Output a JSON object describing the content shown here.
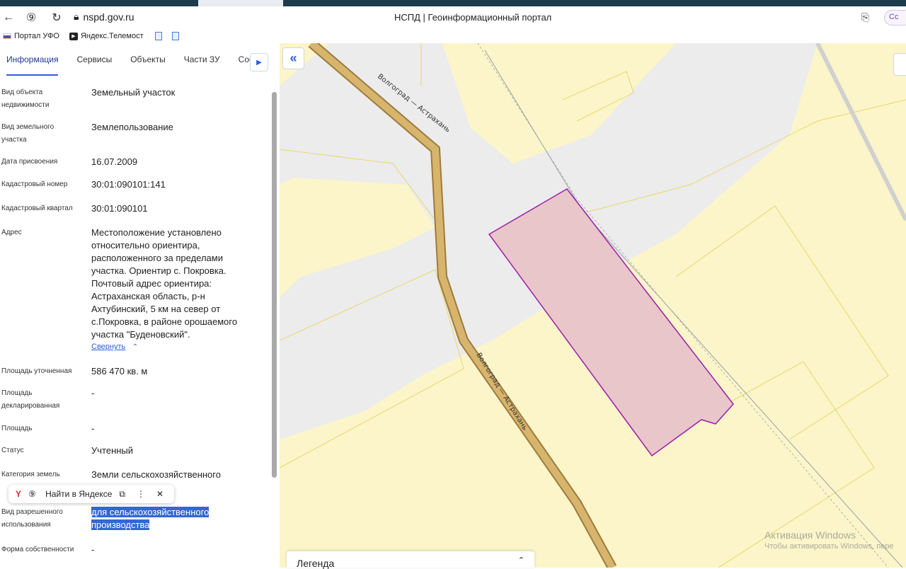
{
  "browser": {
    "url": "nspd.gov.ru",
    "title": "НСПД | Геоинформационный портал",
    "extension_chip": "Сс",
    "bookmarks": [
      {
        "label": "Портал УФО"
      },
      {
        "label": "Яндекс.Телемост"
      }
    ]
  },
  "panel": {
    "tabs": [
      "Информация",
      "Сервисы",
      "Объекты",
      "Части ЗУ",
      "Соста"
    ],
    "active_tab": "Информация",
    "fields": [
      {
        "label": "Вид объекта недвижимости",
        "value": "Земельный участок"
      },
      {
        "label": "Вид земельного участка",
        "value": "Землепользование"
      },
      {
        "label": "Дата присвоения",
        "value": "16.07.2009"
      },
      {
        "label": "Кадастровый номер",
        "value": "30:01:090101:141"
      },
      {
        "label": "Кадастровый квартал",
        "value": "30:01:090101"
      },
      {
        "label": "Адрес",
        "value": "Местоположение установлено относительно ориентира, расположенного за пределами участка. Ориентир с. Покровка. Почтовый адрес ориентира: Астраханская область, р-н Ахтубинский, 5 км на север от с.Покровка, в районе орошаемого участка \"Буденовский\"."
      },
      {
        "label": "Площадь уточненная",
        "value": "586 470 кв. м"
      },
      {
        "label": "Площадь декларированная",
        "value": "-"
      },
      {
        "label": "Площадь",
        "value": "-"
      },
      {
        "label": "Статус",
        "value": "Учтенный"
      },
      {
        "label": "Категория земель",
        "value": "Земли сельскохозяйственного"
      },
      {
        "label": "Вид разрешенного использования",
        "value": "для сельскохозяйственного производства"
      },
      {
        "label": "Форма собственности",
        "value": "-"
      }
    ],
    "collapse_link": "Свернуть"
  },
  "popup": {
    "search_label": "Найти в Яндексе"
  },
  "map": {
    "road_label": "Волгоград — Астрахань",
    "legend_title": "Легенда",
    "watermark_line1": "Активация Windows",
    "watermark_line2": "Чтобы активировать Windows, пере",
    "background_color": "#fbf5c9",
    "parcel_fill": "#e8c6c9",
    "parcel_stroke": "#9b1fa8"
  }
}
